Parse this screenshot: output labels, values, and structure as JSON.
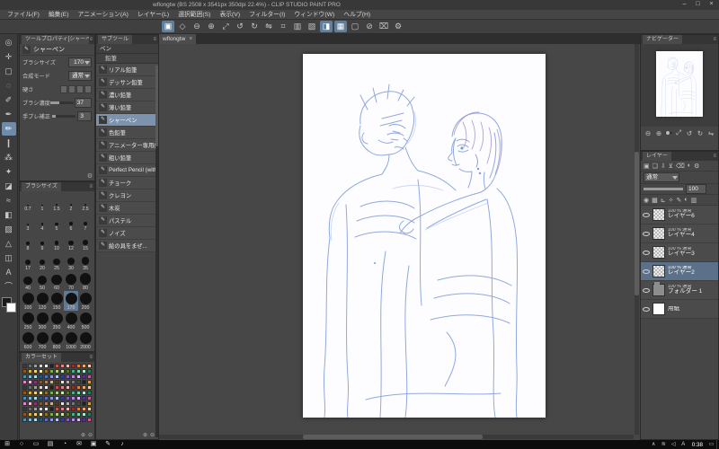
{
  "titlebar": {
    "title": "wflongtw (BS 2508 x 3541px 350dpi 22.4%) - CLIP STUDIO PAINT PRO",
    "buttons": [
      {
        "name": "minimize",
        "glyph": "–"
      },
      {
        "name": "maximize",
        "glyph": "□"
      },
      {
        "name": "close",
        "glyph": "×"
      }
    ]
  },
  "menubar": {
    "items": [
      "ファイル(F)",
      "編集(E)",
      "アニメーション(A)",
      "レイヤー(L)",
      "選択範囲(S)",
      "表示(V)",
      "フィルター(I)",
      "ウィンドウ(W)",
      "ヘルプ(H)"
    ]
  },
  "main_toolbar": {
    "icons": [
      {
        "name": "canvas-view",
        "glyph": "▣",
        "active": true
      },
      {
        "name": "rotate-reset",
        "glyph": "◇"
      },
      {
        "name": "zoom-out",
        "glyph": "⊖"
      },
      {
        "name": "zoom-in",
        "glyph": "⊕"
      },
      {
        "name": "fit-to-screen",
        "glyph": "⤢"
      },
      {
        "name": "rotate-left",
        "glyph": "↺"
      },
      {
        "name": "rotate-right",
        "glyph": "↻"
      },
      {
        "name": "flip-horizontal",
        "glyph": "⇋"
      },
      {
        "name": "grid",
        "glyph": "⌗"
      },
      {
        "name": "ruler",
        "glyph": "▥"
      },
      {
        "name": "snap-ruler",
        "glyph": "▧"
      },
      {
        "name": "snap-special-ruler",
        "glyph": "◨",
        "active": true
      },
      {
        "name": "snap-grid",
        "glyph": "▦",
        "active": true
      },
      {
        "name": "select-area",
        "glyph": "▢"
      },
      {
        "name": "deselect",
        "glyph": "⊘"
      },
      {
        "name": "crop",
        "glyph": "⌧"
      },
      {
        "name": "settings",
        "glyph": "⚙"
      }
    ]
  },
  "tool_strip": {
    "tools": [
      {
        "name": "zoom-tool",
        "glyph": "◎"
      },
      {
        "name": "move-tool",
        "glyph": "✛"
      },
      {
        "name": "selection-tool",
        "glyph": "▢"
      },
      {
        "name": "lasso-tool",
        "glyph": "◌"
      },
      {
        "name": "eyedropper-tool",
        "glyph": "✐"
      },
      {
        "name": "pen-tool",
        "glyph": "✒"
      },
      {
        "name": "pencil-tool",
        "glyph": "✏",
        "active": true
      },
      {
        "name": "brush-tool",
        "glyph": "❙"
      },
      {
        "name": "airbrush-tool",
        "glyph": "⁂"
      },
      {
        "name": "decoration-tool",
        "glyph": "✦"
      },
      {
        "name": "eraser-tool",
        "glyph": "◪"
      },
      {
        "name": "blend-tool",
        "glyph": "≈"
      },
      {
        "name": "fill-tool",
        "glyph": "◧"
      },
      {
        "name": "gradient-tool",
        "glyph": "▨"
      },
      {
        "name": "figure-tool",
        "glyph": "△"
      },
      {
        "name": "frame-border-tool",
        "glyph": "◫"
      },
      {
        "name": "text-tool",
        "glyph": "A"
      },
      {
        "name": "line-correction-tool",
        "glyph": "⌒"
      }
    ],
    "fg_color": "#1a1a1a",
    "bg_color": "#ffffff"
  },
  "tool_property": {
    "header": "ツールプロパティ[シャーペン]",
    "subtool_name": "シャーペン",
    "brush_size_label": "ブラシサイズ",
    "brush_size_value": "170",
    "blend_label": "合成モード",
    "blend_value": "通常",
    "hardness_label": "硬さ",
    "density_label": "ブラシ濃度",
    "density_value": "37",
    "density_percent": 37,
    "stabilize_label": "手ブレ補正",
    "stabilize_value": "3",
    "stabilize_percent": 15,
    "wrench_glyph": "⚙"
  },
  "brush_size_panel": {
    "header": "ブラシサイズ",
    "selected": "170",
    "sizes": [
      "0.7",
      "1",
      "1.5",
      "2",
      "2.5",
      "3",
      "4",
      "5",
      "6",
      "7",
      "8",
      "9",
      "10",
      "12",
      "15",
      "17",
      "20",
      "25",
      "30",
      "35",
      "40",
      "50",
      "60",
      "70",
      "80",
      "100",
      "120",
      "150",
      "170",
      "200",
      "250",
      "300",
      "350",
      "400",
      "500",
      "600",
      "700",
      "800",
      "1000",
      "2000"
    ]
  },
  "color_set_panel": {
    "header": "カラーセット",
    "rows": 11,
    "cols": 13,
    "colors": [
      "#3a3a3a",
      "#6b6b6b",
      "#9e9e9e",
      "#d6d6d6",
      "#f5f5f5",
      "#1f1f1f",
      "#c94f4f",
      "#e08585",
      "#f0b9b9",
      "#8f2f2f",
      "#d97b3f",
      "#eda76f",
      "#f3cfa6",
      "#955722",
      "#d9b33f",
      "#efd27a",
      "#f7e9b8",
      "#8f7522",
      "#7daf4a",
      "#a8cf7e",
      "#d2e8b4",
      "#4f7a26",
      "#4aaf82",
      "#7ecfae",
      "#b4e8d6",
      "#267a54",
      "#4a8faf",
      "#7eb8cf",
      "#b4dce8",
      "#26547a",
      "#5a6fc2",
      "#8a9ade",
      "#bcc6ee",
      "#32408f",
      "#8a5ac2",
      "#b28ade",
      "#d6bcee",
      "#55328f",
      "#c25a9e",
      "#de8ac2",
      "#eebcdc",
      "#8f3270",
      "#7a5a3a",
      "#a8845f",
      "#d0b292",
      "#4f3a24",
      "#e8e8e8",
      "#b0b0b0",
      "#787878",
      "#454545",
      "#202020",
      "#c9a23f"
    ],
    "foot_icons": [
      {
        "name": "add-color",
        "glyph": "⊕"
      },
      {
        "name": "remove-color",
        "glyph": "⊖"
      }
    ]
  },
  "subtool_panel": {
    "header": "サブツール",
    "group_tab": "ペン",
    "section": "鉛筆",
    "items": [
      {
        "label": "リアル鉛筆"
      },
      {
        "label": "デッサン鉛筆"
      },
      {
        "label": "濃い鉛筆"
      },
      {
        "label": "薄い鉛筆"
      },
      {
        "label": "シャーペン",
        "selected": true
      },
      {
        "label": "色鉛筆"
      },
      {
        "label": "アニメーター専用(アウ..."
      },
      {
        "label": "粗い鉛筆"
      },
      {
        "label": "Perfect Pencil (with..."
      },
      {
        "label": "チョーク"
      },
      {
        "label": "クレヨン"
      },
      {
        "label": "木炭"
      },
      {
        "label": "パステル"
      },
      {
        "label": "ノイズ"
      },
      {
        "label": "絵の具をまぜ..."
      }
    ],
    "foot_icons": [
      {
        "name": "add-subtool",
        "glyph": "⊕"
      },
      {
        "name": "delete-subtool",
        "glyph": "⊖"
      }
    ]
  },
  "canvas": {
    "tab_label": "wflongtw",
    "close_glyph": "×"
  },
  "navigator": {
    "header": "ナビゲーター",
    "controls": [
      {
        "name": "nav-zoom-out",
        "glyph": "⊖"
      },
      {
        "name": "nav-zoom-in",
        "glyph": "⊕"
      },
      {
        "name": "nav-fit",
        "glyph": "⤢"
      },
      {
        "name": "nav-rotate-left",
        "glyph": "↺"
      },
      {
        "name": "nav-rotate-right",
        "glyph": "↻"
      },
      {
        "name": "nav-flip",
        "glyph": "⇋"
      }
    ]
  },
  "layer_panel": {
    "header": "レイヤー",
    "toolbar1": [
      {
        "name": "new-raster-layer",
        "glyph": "▣"
      },
      {
        "name": "new-folder",
        "glyph": "❏"
      },
      {
        "name": "transfer-layer",
        "glyph": "⇩"
      },
      {
        "name": "merge-down",
        "glyph": "⊻"
      },
      {
        "name": "delete-layer",
        "glyph": "⌫"
      },
      {
        "name": "layer-mask",
        "glyph": "◐"
      },
      {
        "name": "layer-settings",
        "glyph": "⚙"
      }
    ],
    "blend_mode": "通常",
    "opacity_value": "100",
    "toolbar2": [
      {
        "name": "lock-layer",
        "glyph": "◉"
      },
      {
        "name": "lock-transparent",
        "glyph": "▩"
      },
      {
        "name": "clip-below",
        "glyph": "⊾"
      },
      {
        "name": "reference-layer",
        "glyph": "✧"
      },
      {
        "name": "draft-layer",
        "glyph": "✎"
      },
      {
        "name": "enable-mask",
        "glyph": "◐"
      },
      {
        "name": "ruler-icon",
        "glyph": "▥"
      }
    ],
    "layers": [
      {
        "name": "レイヤー6",
        "meta": "100 % 通常",
        "type": "raster"
      },
      {
        "name": "レイヤー4",
        "meta": "100 % 通常",
        "type": "raster"
      },
      {
        "name": "レイヤー3",
        "meta": "100 % 通常",
        "type": "raster"
      },
      {
        "name": "レイヤー2",
        "meta": "100 % 通常",
        "type": "raster",
        "selected": true
      },
      {
        "name": "フォルダー 1",
        "meta": "100 % 通常",
        "type": "folder"
      },
      {
        "name": "用紙",
        "meta": "",
        "type": "paper"
      }
    ]
  },
  "taskbar": {
    "app_icons": [
      {
        "name": "start",
        "glyph": "⊞"
      },
      {
        "name": "search",
        "glyph": "○"
      },
      {
        "name": "task-view",
        "glyph": "▭"
      },
      {
        "name": "file-explorer",
        "glyph": "▤"
      },
      {
        "name": "browser",
        "glyph": "◔"
      },
      {
        "name": "mail",
        "glyph": "✉"
      },
      {
        "name": "photos",
        "glyph": "▣"
      },
      {
        "name": "clip-studio",
        "glyph": "✎"
      },
      {
        "name": "music",
        "glyph": "♪"
      }
    ],
    "tray_icons": [
      {
        "name": "tray-expand",
        "glyph": "∧"
      },
      {
        "name": "network",
        "glyph": "≋"
      },
      {
        "name": "volume",
        "glyph": "◁"
      },
      {
        "name": "ime-mode",
        "glyph": "A"
      }
    ],
    "time": "0:38",
    "action_center_glyph": "▭"
  },
  "sketch_colors": {
    "main": "#7e9ad8",
    "light": "#b6c4ea",
    "purple": "#9d8bd0"
  }
}
